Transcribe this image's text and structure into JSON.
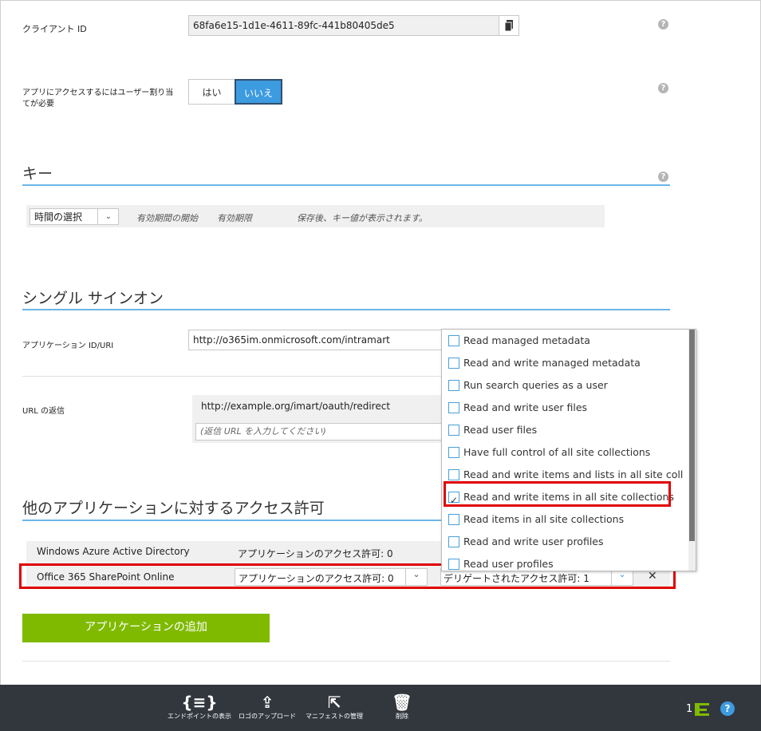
{
  "client_id": {
    "label": "クライアント ID",
    "value": "68fa6e15-1d1e-4611-89fc-441b80405de5",
    "copy_icon": "copy-icon"
  },
  "user_assignment": {
    "label": "アプリにアクセスするにはユーザー割り当てが必要",
    "yes": "はい",
    "no": "いいえ"
  },
  "keys": {
    "title": "キー",
    "duration_select": "時間の選択",
    "col_start": "有効期間の開始",
    "col_expire": "有効期限",
    "note": "保存後、キー値が表示されます。"
  },
  "sso": {
    "title": "シングル サインオン",
    "app_id_label": "アプリケーション ID/URI",
    "app_id_value": "http://o365im.onmicrosoft.com/intramart",
    "reply_label": "URL の返信",
    "reply_value": "http://example.org/imart/oauth/redirect",
    "reply_placeholder": "(返信 URL を入力してください)"
  },
  "permissions": {
    "title": "他のアプリケーションに対するアクセス許可",
    "rows": [
      {
        "name": "Windows Azure Active Directory",
        "app_perm": "アプリケーションのアクセス許可: 0"
      },
      {
        "name": "Office 365 SharePoint Online",
        "app_perm": "アプリケーションのアクセス許可: 0",
        "delegated_perm": "デリゲートされたアクセス許可: 1",
        "remove": "✕"
      }
    ],
    "add_button": "アプリケーションの追加"
  },
  "dropdown": {
    "items": [
      {
        "label": "Read managed metadata",
        "checked": false
      },
      {
        "label": "Read and write managed metadata",
        "checked": false
      },
      {
        "label": "Run search queries as a user",
        "checked": false
      },
      {
        "label": "Read and write user files",
        "checked": false
      },
      {
        "label": "Read user files",
        "checked": false
      },
      {
        "label": "Have full control of all site collections",
        "checked": false
      },
      {
        "label": "Read and write items and lists in all site collecti...",
        "checked": false
      },
      {
        "label": "Read and write items in all site collections",
        "checked": true
      },
      {
        "label": "Read items in all site collections",
        "checked": false
      },
      {
        "label": "Read and write user profiles",
        "checked": false
      },
      {
        "label": "Read user profiles",
        "checked": false
      }
    ]
  },
  "bottom_bar": {
    "items": [
      {
        "label": "エンドポイントの表示",
        "icon": "endpoints-icon"
      },
      {
        "label": "ロゴのアップロード",
        "icon": "upload-icon"
      },
      {
        "label": "マニフェストの管理",
        "icon": "manifest-icon"
      },
      {
        "label": "削除",
        "icon": "trash-icon"
      }
    ],
    "notification_count": "1"
  },
  "colors": {
    "accent": "#3d9be0",
    "add_button": "#7fba00",
    "highlight": "#e00000",
    "bar": "#32373e"
  }
}
